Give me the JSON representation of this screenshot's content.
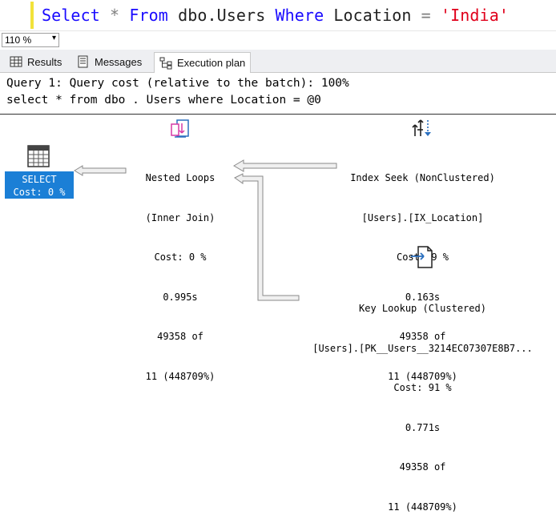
{
  "editor": {
    "kw_select": "Select",
    "star": "*",
    "kw_from": "From",
    "table": "dbo.Users",
    "kw_where": "Where",
    "column": "Location",
    "equals": "=",
    "literal": "'India'"
  },
  "zoom": {
    "value": "110 %"
  },
  "tabs": [
    {
      "label": "Results"
    },
    {
      "label": "Messages"
    },
    {
      "label": "Execution plan"
    }
  ],
  "header": {
    "line1": "Query 1: Query cost (relative to the batch): 100%",
    "line2": "select * from dbo . Users where Location = @0"
  },
  "nodes": {
    "select": {
      "title": "SELECT",
      "cost": "Cost: 0 %"
    },
    "nested_loops": {
      "title": "Nested Loops",
      "subtitle": "(Inner Join)",
      "cost": "Cost: 0 %",
      "time": "0.995s",
      "rows": "49358 of",
      "estimate": "11 (448709%)"
    },
    "index_seek": {
      "title": "Index Seek (NonClustered)",
      "object": "[Users].[IX_Location]",
      "cost": "Cost: 9 %",
      "time": "0.163s",
      "rows": "49358 of",
      "estimate": "11 (448709%)"
    },
    "key_lookup": {
      "title": "Key Lookup (Clustered)",
      "object": "[Users].[PK__Users__3214EC07307E8B7...",
      "cost": "Cost: 91 %",
      "time": "0.771s",
      "rows": "49358 of",
      "estimate": "11 (448709%)"
    }
  },
  "colors": {
    "keyword": "#1a0bff",
    "string": "#e0001b",
    "selected_node": "#1b7fd6"
  }
}
